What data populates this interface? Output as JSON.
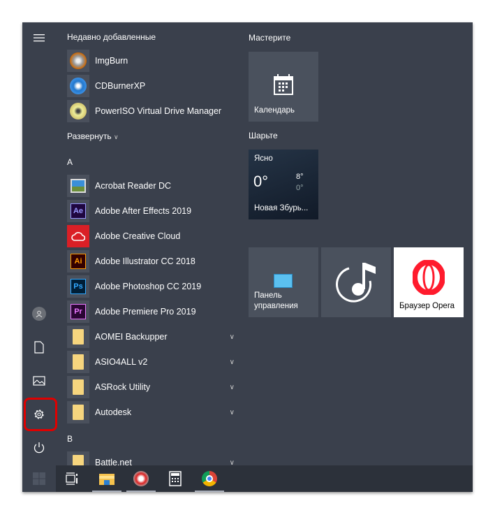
{
  "sidebar": {
    "items": [
      {
        "name": "menu",
        "icon": "hamburger-icon"
      },
      {
        "name": "user",
        "icon": "user-icon"
      },
      {
        "name": "documents",
        "icon": "document-icon"
      },
      {
        "name": "pictures",
        "icon": "image-icon"
      },
      {
        "name": "settings",
        "icon": "gear-icon",
        "highlighted": true
      },
      {
        "name": "power",
        "icon": "power-icon"
      }
    ]
  },
  "highlight_color": "#e00000",
  "recent": {
    "title": "Недавно добавленные",
    "items": [
      {
        "label": "ImgBurn"
      },
      {
        "label": "CDBurnerXP"
      },
      {
        "label": "PowerISO Virtual Drive Manager"
      }
    ],
    "expand": "Развернуть"
  },
  "groups": [
    {
      "letter": "A",
      "items": [
        {
          "label": "Acrobat Reader DC"
        },
        {
          "label": "Adobe After Effects 2019",
          "abbr": "Ae",
          "color": "#9999ff"
        },
        {
          "label": "Adobe Creative Cloud"
        },
        {
          "label": "Adobe Illustrator CC 2018",
          "abbr": "Ai",
          "color": "#ff9a00"
        },
        {
          "label": "Adobe Photoshop CC 2019",
          "abbr": "Ps",
          "color": "#31a8ff"
        },
        {
          "label": "Adobe Premiere Pro 2019",
          "abbr": "Pr",
          "color": "#ea77ff"
        },
        {
          "label": "AOMEI Backupper"
        },
        {
          "label": "ASIO4ALL v2"
        },
        {
          "label": "ASRock Utility"
        },
        {
          "label": "Autodesk"
        }
      ]
    },
    {
      "letter": "B",
      "items": [
        {
          "label": "Battle.net"
        }
      ]
    }
  ],
  "tiles": {
    "group1": "Мастерите",
    "calendar": "Календарь",
    "group2": "Шарьте",
    "weather": {
      "condition": "Ясно",
      "temp": "0°",
      "high": "8°",
      "low": "0°",
      "location": "Новая Збурь..."
    },
    "control_panel_1": "Панель",
    "control_panel_2": "управления",
    "opera": "Браузер Opera"
  },
  "taskbar": {
    "items": [
      "task-view",
      "file-explorer",
      "app-red",
      "calculator",
      "chrome"
    ]
  }
}
